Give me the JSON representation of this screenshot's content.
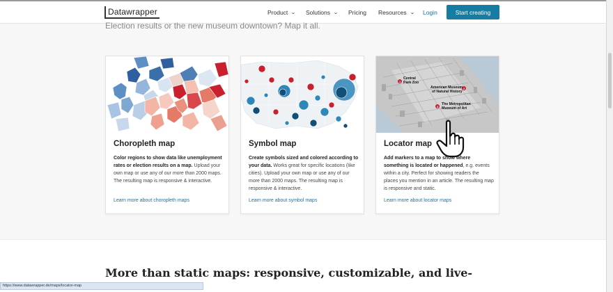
{
  "header": {
    "logo": "Datawrapper",
    "nav": [
      {
        "label": "Product",
        "has_dropdown": true
      },
      {
        "label": "Solutions",
        "has_dropdown": true
      },
      {
        "label": "Pricing",
        "has_dropdown": false
      },
      {
        "label": "Resources",
        "has_dropdown": true
      }
    ],
    "login": "Login",
    "cta": "Start creating",
    "chevron": "⌄"
  },
  "subheading": "Election results or the new museum downtown? Map it all.",
  "cards": [
    {
      "title": "Choropleth map",
      "desc_bold": "Color regions to show data like unemployment rates or election results on a map.",
      "desc_rest": " Upload your own map or use any of our more than 2000 maps. The resulting map is responsive & interactive.",
      "link": "Learn more about choropleth maps"
    },
    {
      "title": "Symbol map",
      "desc_bold": "Create symbols sized and colored according to your data.",
      "desc_rest": " Works great for specific locations (like cities). Upload your own map or use any of our more than 2000 maps. The resulting map is responsive & interactive.",
      "link": "Learn more about symbol maps"
    },
    {
      "title": "Locator map",
      "desc_bold": "Add markers to a map to show where something is located or happened",
      "desc_rest": ", e.g. events within a city. Perfect for showing readers the places you mention in an article. The resulting map is responsive and static.",
      "link": "Learn more about locator maps",
      "markers": [
        {
          "num": "1",
          "label1": "Central",
          "label2": "Park Zoo"
        },
        {
          "num": "2",
          "label1": "American Museum",
          "label2": "of Natural History"
        },
        {
          "num": "3",
          "label1": "The Metropolitan",
          "label2": "Museum of Art"
        }
      ]
    }
  ],
  "section2_heading": "More than static maps: responsive, customizable, and live-",
  "status_url": "https://www.datawrapper.de/maps/locator-map",
  "colors": {
    "accent": "#167ca3",
    "link": "#1f6f9f",
    "choropleth_blue": "#3b6fa9",
    "choropleth_red": "#c9202f"
  }
}
